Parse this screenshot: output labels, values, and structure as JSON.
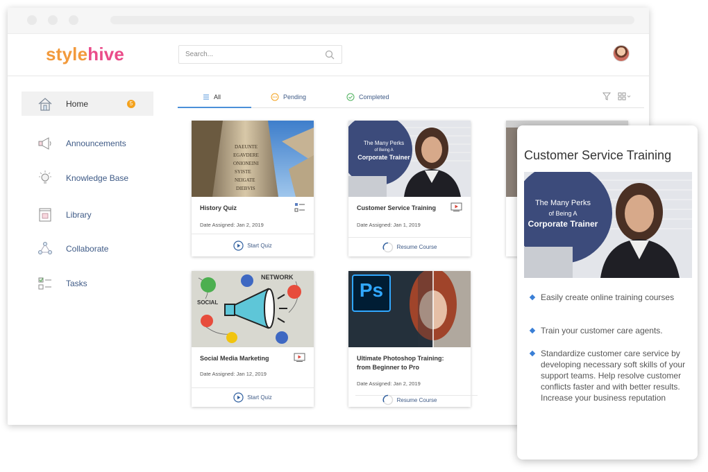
{
  "header": {
    "logo_part1": "style",
    "logo_part2": "hive",
    "search_placeholder": "Search..."
  },
  "sidebar": {
    "items": [
      {
        "label": "Home",
        "badge": "5",
        "icon": "home-icon"
      },
      {
        "label": "Announcements",
        "icon": "megaphone-icon"
      },
      {
        "label": "Knowledge Base",
        "icon": "lightbulb-icon"
      },
      {
        "label": "Library",
        "icon": "book-icon"
      },
      {
        "label": "Collaborate",
        "icon": "network-icon"
      },
      {
        "label": "Tasks",
        "icon": "tasks-icon"
      }
    ]
  },
  "tabs": [
    {
      "label": "All",
      "icon": "list-icon"
    },
    {
      "label": "Pending",
      "icon": "pending-icon"
    },
    {
      "label": "Completed",
      "icon": "check-circle-icon"
    }
  ],
  "cards": [
    {
      "title": "History Quiz",
      "date_label": "Date Assigned:",
      "date": "Jan 2, 2019",
      "action": "Start Quiz",
      "type_icon": "quiz-icon",
      "action_icon": "play-circle-icon"
    },
    {
      "title": "Customer Service Training",
      "date_label": "Date Assigned:",
      "date": "Jan 1, 2019",
      "action": "Resume Course",
      "type_icon": "video-icon",
      "action_icon": "progress-icon",
      "thumb_line1": "The Many Perks",
      "thumb_line2": "of Being A",
      "thumb_line3": "Corporate Trainer"
    },
    {
      "title": "Social Media Marketing",
      "date_label": "Date Assigned:",
      "date": "Jan 12, 2019",
      "action": "Start Quiz",
      "type_icon": "video-icon",
      "action_icon": "play-circle-icon"
    },
    {
      "title": "Ultimate Photoshop Training: from Beginner to Pro",
      "date_label": "Date Assigned:",
      "date": "Jan 2, 2019",
      "action": "Resume Course",
      "type_icon": "none",
      "action_icon": "progress-icon",
      "thumb_logo": "Ps"
    }
  ],
  "popup": {
    "title": "Customer Service Training",
    "img_line1": "The Many Perks",
    "img_line2": "of Being A",
    "img_line3": "Corporate Trainer",
    "bullets": [
      "Easily create online training courses",
      "Train your customer care agents.",
      "Standardize customer care service by developing necessary soft skills of your support teams. Help resolve customer conflicts faster and with better results. Increase your business reputation"
    ]
  },
  "colors": {
    "accent_blue": "#4a8fd8",
    "badge_orange": "#f4a21d",
    "logo_orange": "#f29a3c",
    "logo_pink": "#ea4c89",
    "link_blue": "#3e5a86"
  }
}
